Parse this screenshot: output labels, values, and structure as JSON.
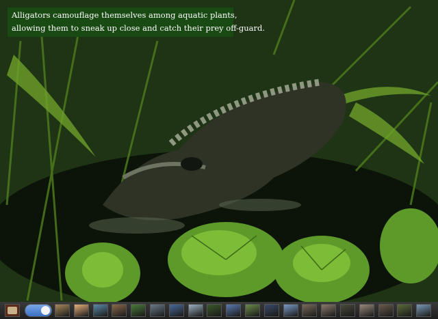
{
  "caption": {
    "line1": "Alligators camouflage themselves among aquatic plants,",
    "line2": "allowing them to sneak up close and catch their prey off-guard."
  },
  "toolbar": {
    "home_icon": "home-icon",
    "slider_icon": "slider-knob",
    "thumbnails": [
      {
        "color": "#a88a5a"
      },
      {
        "color": "#e8b07a"
      },
      {
        "color": "#5a8aa8"
      },
      {
        "color": "#8a6a4a"
      },
      {
        "color": "#4a7a3a"
      },
      {
        "color": "#6a7a8a"
      },
      {
        "color": "#4a6a9a"
      },
      {
        "color": "#9ab0c0"
      },
      {
        "color": "#3a5a2a"
      },
      {
        "color": "#5a7ab0"
      },
      {
        "color": "#6a8a4a"
      },
      {
        "color": "#3a4a6a"
      },
      {
        "color": "#7a9ac8"
      },
      {
        "color": "#7a6a5a"
      },
      {
        "color": "#8a7a6a"
      },
      {
        "color": "#4a4a3a"
      },
      {
        "color": "#9a8a7a"
      },
      {
        "color": "#6a5a4a"
      },
      {
        "color": "#5a6a3a"
      },
      {
        "color": "#7a9ab8"
      }
    ]
  }
}
